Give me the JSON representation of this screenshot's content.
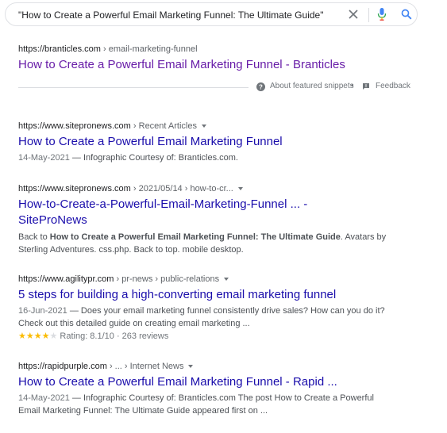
{
  "search": {
    "query": "\"How to Create a Powerful Email Marketing Funnel: The Ultimate Guide\""
  },
  "featured": {
    "domain": "https://branticles.com",
    "path": " › email-marketing-funnel",
    "title": "How to Create a Powerful Email Marketing Funnel - Branticles",
    "about_label": "About featured snippets",
    "separator": "•",
    "feedback_label": "Feedback"
  },
  "results": [
    {
      "domain": "https://www.sitepronews.com",
      "path": " › Recent Articles",
      "title": "How to Create a Powerful Email Marketing Funnel",
      "date": "14-May-2021",
      "snippet": " — Infographic Courtesy of: Branticles.com."
    },
    {
      "domain": "https://www.sitepronews.com",
      "path": " › 2021/05/14 › how-to-cr...",
      "title_line1": "How-to-Create-a-Powerful-Email-Marketing-Funnel ... -",
      "title_line2": "SiteProNews",
      "snippet_pre": "Back to ",
      "snippet_bold": "How to Create a Powerful Email Marketing Funnel: The Ultimate Guide",
      "snippet_post": ". Avatars by",
      "snippet_line2": "Sterling Adventures. css.php. Back to top. mobile desktop."
    },
    {
      "domain": "https://www.agilitypr.com",
      "path": " › pr-news › public-relations",
      "title": "5 steps for building a high-converting email marketing funnel",
      "date": "16-Jun-2021",
      "snippet_line1": " — Does your email marketing funnel consistently drive sales? How can you do it?",
      "snippet_line2": "Check out this detailed guide on creating email marketing ...",
      "stars_filled": "★★★★",
      "stars_empty": "★",
      "rating": 8.1,
      "rating_text": "Rating: 8.1/10 · 263 reviews"
    },
    {
      "domain": "https://rapidpurple.com",
      "path": " › ... › Internet News",
      "title": "How to Create a Powerful Email Marketing Funnel - Rapid ...",
      "date": "14-May-2021",
      "snippet_line1": " — Infographic Courtesy of: Branticles.com The post How to Create a Powerful",
      "snippet_line2": "Email Marketing Funnel: The Ultimate Guide appeared first on ..."
    }
  ],
  "colors": {
    "link": "#1a0dab",
    "visited": "#681da8",
    "star": "#fbbc04"
  }
}
